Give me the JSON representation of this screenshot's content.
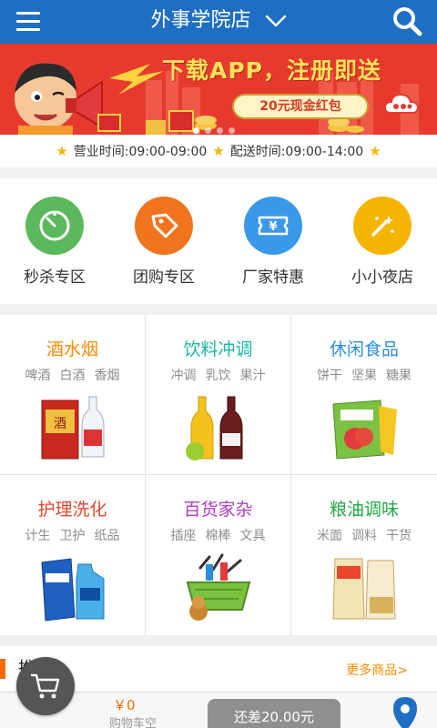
{
  "header": {
    "store_name": "外事学院店",
    "menu_icon": "menu-icon",
    "dropdown_icon": "chevron-down-icon",
    "search_icon": "search-icon",
    "color": "#1e6fc3"
  },
  "banner": {
    "headline": "下载APP，注册即送",
    "pill": "20元现金红包",
    "slide_count": 4,
    "active_slide": 1,
    "background": "#e73a2f"
  },
  "hours": {
    "business": "营业时间:09:00-09:00",
    "delivery": "配送时间:09:00-14:00",
    "star_icon": "star-icon"
  },
  "quick_entries": [
    {
      "label": "秒杀专区",
      "icon": "timer-icon",
      "color": "#5cb85c"
    },
    {
      "label": "团购专区",
      "icon": "tag-icon",
      "color": "#f0741e"
    },
    {
      "label": "厂家特惠",
      "icon": "ticket-yen-icon",
      "color": "#3a98e8"
    },
    {
      "label": "小小夜店",
      "icon": "magic-wand-icon",
      "color": "#f5b400"
    }
  ],
  "categories": [
    {
      "title": "酒水烟",
      "color": "#ff8a00",
      "subs": [
        "啤酒",
        "白酒",
        "香烟"
      ],
      "image": "liquor-image"
    },
    {
      "title": "饮料冲调",
      "color": "#16b8a3",
      "subs": [
        "冲调",
        "乳饮",
        "果汁"
      ],
      "image": "drinks-image"
    },
    {
      "title": "休闲食品",
      "color": "#2a8fd8",
      "subs": [
        "饼干",
        "坚果",
        "糖果"
      ],
      "image": "snacks-image"
    },
    {
      "title": "护理洗化",
      "color": "#e8452c",
      "subs": [
        "计生",
        "卫护",
        "纸品"
      ],
      "image": "detergent-image"
    },
    {
      "title": "百货家杂",
      "color": "#b43cc8",
      "subs": [
        "插座",
        "棉棒",
        "文具"
      ],
      "image": "basket-image"
    },
    {
      "title": "粮油调味",
      "color": "#1fa843",
      "subs": [
        "米面",
        "调料",
        "干货"
      ],
      "image": "rice-image"
    }
  ],
  "section": {
    "title_visible": "推",
    "more": "更多商品>"
  },
  "bottom_bar": {
    "price": "￥0",
    "cart_label": "购物车空",
    "checkout": "还差20.00元",
    "cart_icon": "cart-icon",
    "location_icon": "location-pin-icon"
  }
}
